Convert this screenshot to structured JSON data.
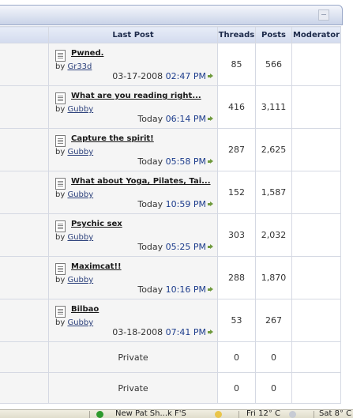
{
  "columns": {
    "last_post": "Last Post",
    "threads": "Threads",
    "posts": "Posts",
    "moderator": "Moderator"
  },
  "forums": [
    {
      "title": "Pwned.",
      "by": "by",
      "user": "Gr33d",
      "date": "03-17-2008",
      "time": "02:47 PM",
      "threads": "85",
      "posts": "566"
    },
    {
      "title": "What are you reading right...",
      "by": "by",
      "user": "Gubby",
      "date": "Today",
      "time": "06:14 PM",
      "threads": "416",
      "posts": "3,111"
    },
    {
      "title": "Capture the spirit!",
      "by": "by",
      "user": "Gubby",
      "date": "Today",
      "time": "05:58 PM",
      "threads": "287",
      "posts": "2,625"
    },
    {
      "title": "What about Yoga, Pilates, Tai...",
      "by": "by",
      "user": "Gubby",
      "date": "Today",
      "time": "10:59 PM",
      "threads": "152",
      "posts": "1,587"
    },
    {
      "title": "Psychic sex",
      "by": "by",
      "user": "Gubby",
      "date": "Today",
      "time": "05:25 PM",
      "threads": "303",
      "posts": "2,032"
    },
    {
      "title": "Maximcat!!",
      "by": "by",
      "user": "Gubby",
      "date": "Today",
      "time": "10:16 PM",
      "threads": "288",
      "posts": "1,870"
    },
    {
      "title": "Bilbao",
      "by": "by",
      "user": "Gubby",
      "date": "03-18-2008",
      "time": "07:41 PM",
      "threads": "53",
      "posts": "267"
    }
  ],
  "private_rows": [
    {
      "last_post": "Private",
      "threads": "0",
      "posts": "0"
    },
    {
      "last_post": "Private",
      "threads": "0",
      "posts": "0"
    }
  ],
  "taskbar": {
    "item1": "New Pat Sh...k F'S",
    "item2": "Fri 12° C",
    "item3": "Sat 8° C"
  },
  "colors": {
    "time_blue": "#1c3c8c",
    "user_link": "#2a3f7a",
    "header_bg": "#d3dbee"
  }
}
